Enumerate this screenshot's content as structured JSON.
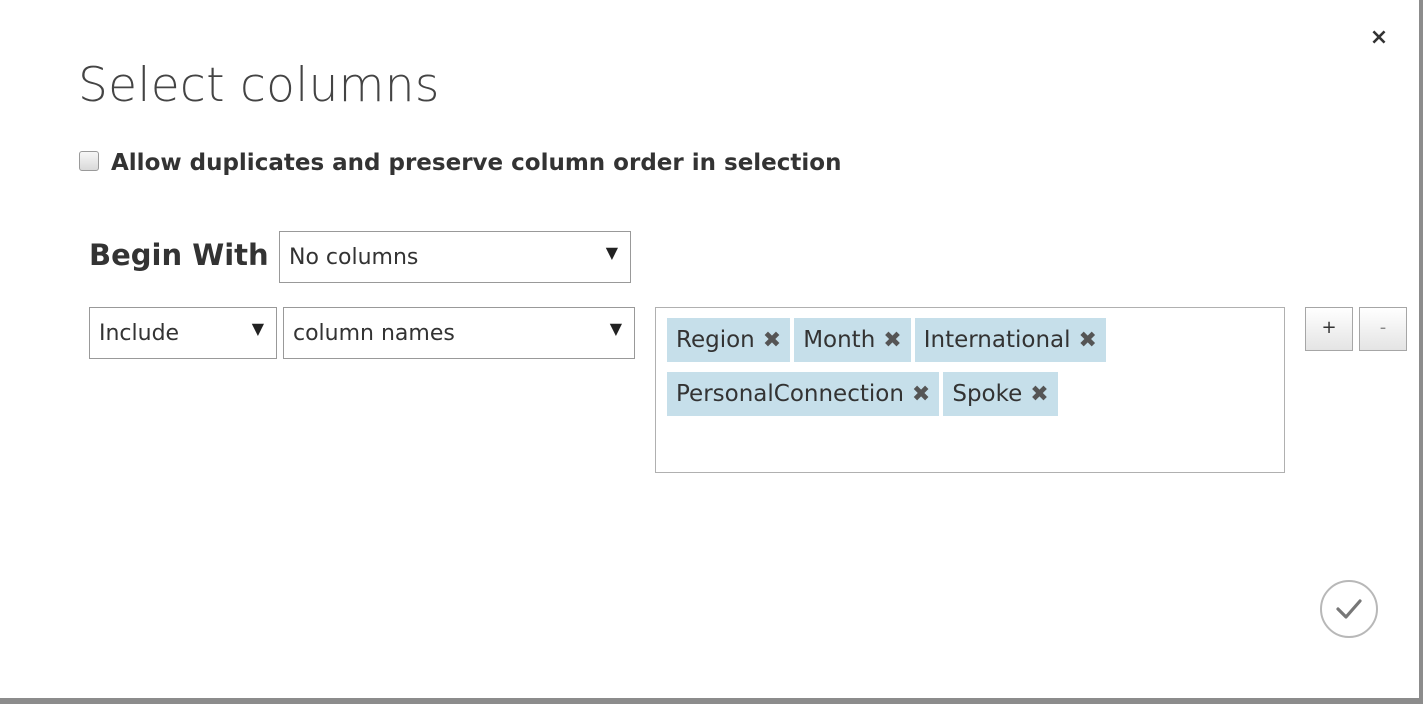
{
  "dialog": {
    "title": "Select columns",
    "close_icon": "close-icon",
    "close_glyph": "×",
    "allow_duplicates": {
      "label": "Allow duplicates and preserve column order in selection",
      "checked": false
    },
    "begin_with": {
      "label": "Begin With",
      "selected": "No columns"
    },
    "rule": {
      "mode": "Include",
      "kind": "column names",
      "columns": [
        "Region",
        "Month",
        "International",
        "PersonalConnection",
        "Spoke"
      ]
    },
    "buttons": {
      "add": "+",
      "remove": "-",
      "confirm_icon": "checkmark-icon"
    },
    "colors": {
      "tag_background": "#c6dfea",
      "border": "#8c8c8c"
    }
  }
}
